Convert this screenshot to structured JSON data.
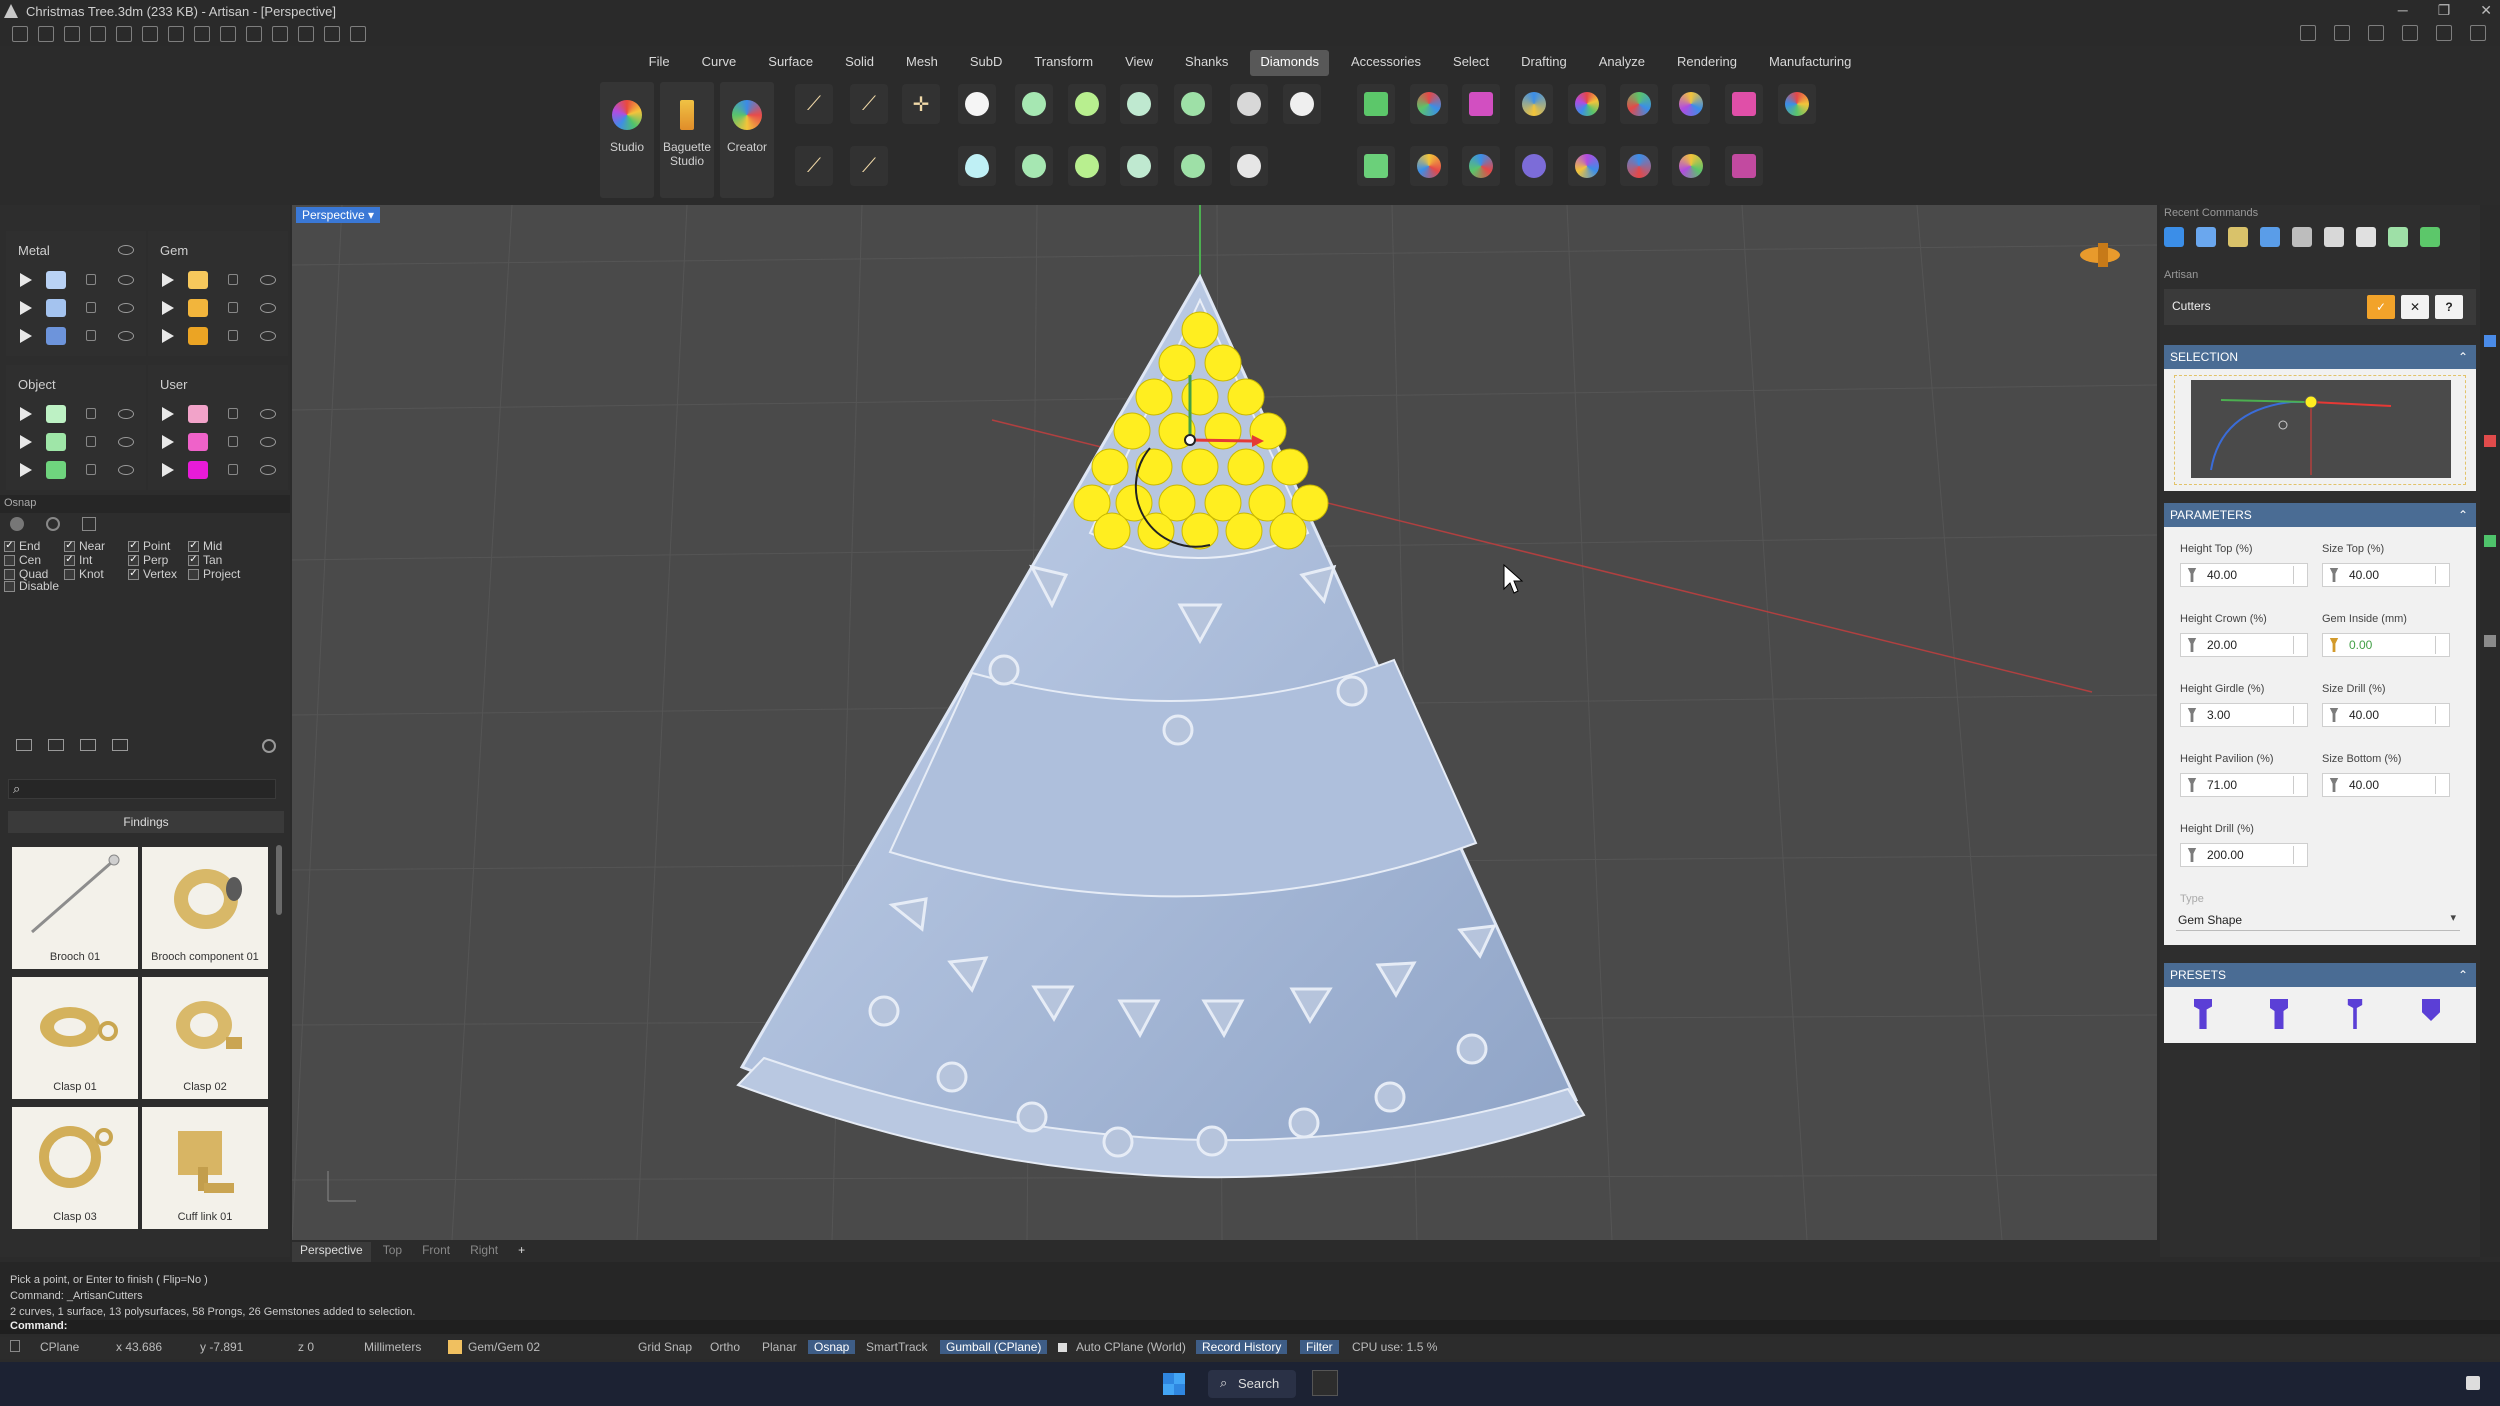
{
  "titlebar": {
    "title": "Christmas Tree.3dm (233 KB) - Artisan - [Perspective]"
  },
  "menu": [
    "File",
    "Curve",
    "Surface",
    "Solid",
    "Mesh",
    "SubD",
    "Transform",
    "View",
    "Shanks",
    "Diamonds",
    "Accessories",
    "Select",
    "Drafting",
    "Analyze",
    "Rendering",
    "Manufacturing"
  ],
  "menu_active": "Diamonds",
  "ribbon": {
    "studio": "Studio",
    "baguette1": "Baguette",
    "baguette2": "Studio",
    "creator": "Creator"
  },
  "layers": {
    "metal_title": "Metal",
    "gem_title": "Gem",
    "object_title": "Object",
    "user_title": "User",
    "metal_colors": [
      "#b9d2f5",
      "#a4c3ef",
      "#6d94db"
    ],
    "gem_colors": [
      "#f7c85c",
      "#f2b53c",
      "#eba424"
    ],
    "object_colors": [
      "#bdf1c4",
      "#9fe6a8",
      "#6fd47e"
    ],
    "user_colors": [
      "#f2a3c9",
      "#ef62c9",
      "#e81bd8"
    ]
  },
  "osnap": {
    "title": "Osnap",
    "items": [
      {
        "label": "End",
        "checked": true
      },
      {
        "label": "Near",
        "checked": true
      },
      {
        "label": "Point",
        "checked": true
      },
      {
        "label": "Mid",
        "checked": true
      },
      {
        "label": "Cen",
        "checked": false
      },
      {
        "label": "Int",
        "checked": true
      },
      {
        "label": "Perp",
        "checked": true
      },
      {
        "label": "Tan",
        "checked": true
      },
      {
        "label": "Quad",
        "checked": false
      },
      {
        "label": "Knot",
        "checked": false
      },
      {
        "label": "Vertex",
        "checked": true
      },
      {
        "label": "Project",
        "checked": false
      }
    ],
    "disable": "Disable"
  },
  "findings": {
    "title": "Findings",
    "items": [
      "Brooch 01",
      "Brooch component 01",
      "Clasp 01",
      "Clasp 02",
      "Clasp 03",
      "Cuff link 01"
    ]
  },
  "viewport": {
    "label": "Perspective",
    "tabs": [
      "Perspective",
      "Top",
      "Front",
      "Right"
    ]
  },
  "right_panel": {
    "recent_commands": "Recent Commands",
    "artisan": "Artisan",
    "cutters": "Cutters",
    "selection": "SELECTION",
    "parameters": "PARAMETERS",
    "presets": "PRESETS",
    "params": [
      {
        "label": "Height Top (%)",
        "value": "40.00"
      },
      {
        "label": "Size Top (%)",
        "value": "40.00"
      },
      {
        "label": "Height Crown (%)",
        "value": "20.00"
      },
      {
        "label": "Gem Inside (mm)",
        "value": "0.00"
      },
      {
        "label": "Height Girdle (%)",
        "value": "3.00"
      },
      {
        "label": "Size Drill (%)",
        "value": "40.00"
      },
      {
        "label": "Height Pavilion (%)",
        "value": "71.00"
      },
      {
        "label": "Size Bottom (%)",
        "value": "40.00"
      },
      {
        "label": "Height Drill (%)",
        "value": "200.00"
      }
    ],
    "type_label": "Type",
    "type_value": "Gem Shape"
  },
  "command": {
    "lines": [
      "Pick a point, or Enter to finish ( Flip=No )",
      "Command: _ArtisanCutters",
      "2 curves, 1 surface, 13 polysurfaces, 58 Prongs, 26 Gemstones added to selection."
    ],
    "prompt": "Command:"
  },
  "status": {
    "cplane": "CPlane",
    "x": "x 43.686",
    "y": "y -7.891",
    "z": "z 0",
    "units": "Millimeters",
    "layer": "Gem/Gem 02",
    "grid": "Grid Snap",
    "ortho": "Ortho",
    "planar": "Planar",
    "osnap": "Osnap",
    "smarttrack": "SmartTrack",
    "gumball": "Gumball (CPlane)",
    "autocplane": "Auto CPlane (World)",
    "record": "Record History",
    "filter": "Filter",
    "cpu": "CPU use: 1.5 %"
  },
  "taskbar": {
    "search": "Search"
  }
}
